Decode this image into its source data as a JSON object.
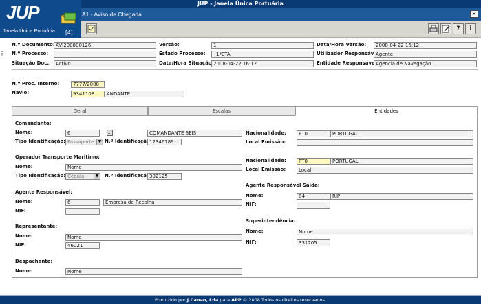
{
  "app": {
    "title": "JUP - Janela Única Portuária",
    "logo_text": "JUP",
    "logo_subtitle": "Janela Única Portuária",
    "screen_title": "A1 - Aviso de Chegada",
    "mail_count": "[4]"
  },
  "header": {
    "n_documento": {
      "label": "N.º Documento:",
      "value": "AVI200800126"
    },
    "versao": {
      "label": "Versão:",
      "value": "1"
    },
    "data_hora_versao": {
      "label": "Data/Hora Versão:",
      "value": "2008-04-22 16:12"
    },
    "n_processo": {
      "label": "N.º Processo:",
      "value": ""
    },
    "estado_processo": {
      "label": "Estado Processo:",
      "value": "1ªETA"
    },
    "utilizador_responsavel": {
      "label": "Utilizador Responsável:",
      "value": "Agente"
    },
    "situacao_doc": {
      "label": "Situação Doc.:",
      "value": "Activo"
    },
    "data_hora_situacao": {
      "label": "Data/Hora Situação:",
      "value": "2008-04-22 16:12"
    },
    "entidade_responsavel": {
      "label": "Entidade Responsável:",
      "value": "Agencia de Navegação"
    },
    "n_proc_interno": {
      "label": "N.º Proc. Interno:",
      "value": "7777/2008"
    },
    "navio": {
      "label": "Navio:",
      "code": "9341108",
      "name": "ANDANTE"
    }
  },
  "tabs": [
    "Geral",
    "Escalas",
    "Entidades"
  ],
  "entidades": {
    "comandante": {
      "title": "Comandante:",
      "nome_label": "Nome:",
      "nome_code": "6",
      "nome_value": "COMANDANTE SEIS",
      "tipo_id_label": "Tipo Identificação:",
      "tipo_id_value": "Passaporte",
      "n_id_label": "N.º Identificação:",
      "n_id_value": "12346789",
      "nacionalidade_label": "Nacionalidade:",
      "nac_code": "PT0",
      "nac_name": "PORTUGAL",
      "local_emissao_label": "Local Emissão:",
      "local_emissao_value": ""
    },
    "operador": {
      "title": "Operador Transporte Maritimo:",
      "nome_label": "Nome:",
      "nome_value": "Nome",
      "tipo_id_label": "Tipo Identificação:",
      "tipo_id_value": "Cédula",
      "n_id_label": "N.º Identificação:",
      "n_id_value": "302125",
      "nacionalidade_label": "Nacionalidade:",
      "nac_code": "PT0",
      "nac_name": "PORTUGAL",
      "local_emissao_label": "Local Emissão:",
      "local_emissao_value": "Local"
    },
    "agente": {
      "title": "Agente Responsável:",
      "nome_label": "Nome:",
      "nome_code": "6",
      "nome_value": "Empresa de Recolha",
      "nif_label": "NIF:",
      "nif_value": ""
    },
    "agente_saida": {
      "title": "Agente Responsável Saída:",
      "nome_label": "Nome:",
      "nome_code": "84",
      "nome_value": "RIP",
      "nif_label": "NIF:",
      "nif_value": ""
    },
    "representante": {
      "title": "Representante:",
      "nome_label": "Nome:",
      "nome_value": "Nome",
      "nif_label": "NIF:",
      "nif_value": "46021"
    },
    "superintendencia": {
      "title": "Superintendência:",
      "nome_label": "Nome:",
      "nome_value": "Nome",
      "nif_label": "NIF:",
      "nif_value": "331205"
    },
    "despachante": {
      "title": "Despachante:",
      "nome_label": "Nome:",
      "nome_value": "Nome"
    }
  },
  "footer": {
    "prefix": "Produzido por ",
    "company": "J.Canao, Lda",
    "middle": " para ",
    "app": "APP",
    "suffix": " © 2008 Todos os direitos reservados."
  },
  "icons": [
    "mail-icon",
    "note-icon",
    "print-icon",
    "edit-icon",
    "help-icon",
    "info-icon",
    "close-icon"
  ]
}
